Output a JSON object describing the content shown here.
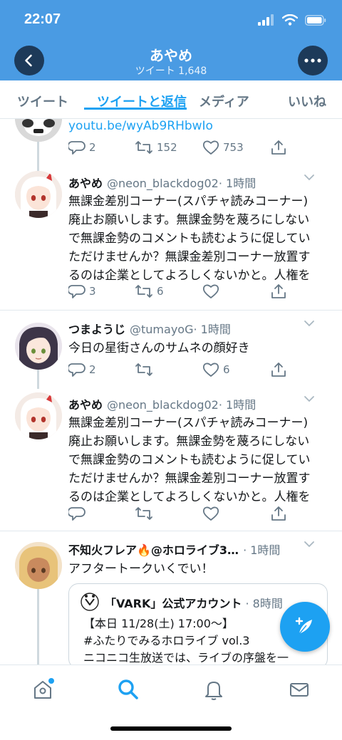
{
  "status_bar": {
    "time": "22:07"
  },
  "profile": {
    "title": "あやめ",
    "subtitle": "ツイート 1,648"
  },
  "tabs": [
    {
      "label": "ツイート"
    },
    {
      "label": "ツイートと返信"
    },
    {
      "label": "メディア"
    },
    {
      "label": "いいね"
    }
  ],
  "tweets": [
    {
      "partial": true,
      "link_text": "youtu.be/wyAb9RHbwIo",
      "replies": "2",
      "retweets": "152",
      "likes": "753"
    },
    {
      "name": "あやめ",
      "handle": "@neon_blackdog02",
      "time": "· 1時間",
      "lines": [
        "無課金差別コーナー(スパチャ読みコーナー)",
        "廃止お願いします。無課金勢を蔑ろにしない",
        "で無課金勢のコメントも読むように促してい",
        "ただけませんか？無課金差別コーナー放置す",
        "るのは企業としてよろしくないかと。人権を"
      ],
      "replies": "3",
      "retweets": "6",
      "likes": ""
    },
    {
      "name": "つまようじ",
      "handle": "@tumayoG",
      "time": "· 1時間",
      "lines": [
        "今日の星街さんのサムネの顔好き"
      ],
      "replies": "2",
      "retweets": "",
      "likes": "6"
    },
    {
      "name": "あやめ",
      "handle": "@neon_blackdog02",
      "time": "· 1時間",
      "lines": [
        "無課金差別コーナー(スパチャ読みコーナー)",
        "廃止お願いします。無課金勢を蔑ろにしない",
        "で無課金勢のコメントも読むように促してい",
        "ただけませんか？無課金差別コーナー放置す",
        "るのは企業としてよろしくないかと。人権を"
      ],
      "replies": "",
      "retweets": "",
      "likes": ""
    },
    {
      "name": "不知火フレア🔥@ホロライブ3…",
      "handle": "",
      "time": "· 1時間",
      "lines": [
        "アフタートークいくでい！"
      ],
      "quote": {
        "name": "「VARK」公式アカウント",
        "time": "· 8時間",
        "lines": [
          "【本日 11/28(土) 17:00〜】",
          "#ふたりでみるホロライブ vol.3",
          "ニコニコ生放送では、ライブの序盤を一"
        ]
      }
    }
  ],
  "bottom_nav": [
    {
      "icon": "home-icon"
    },
    {
      "icon": "search-icon"
    },
    {
      "icon": "bell-icon"
    },
    {
      "icon": "mail-icon"
    }
  ],
  "colors": {
    "header": "#4a9be3",
    "accent": "#1da1f2",
    "muted": "#657786"
  }
}
